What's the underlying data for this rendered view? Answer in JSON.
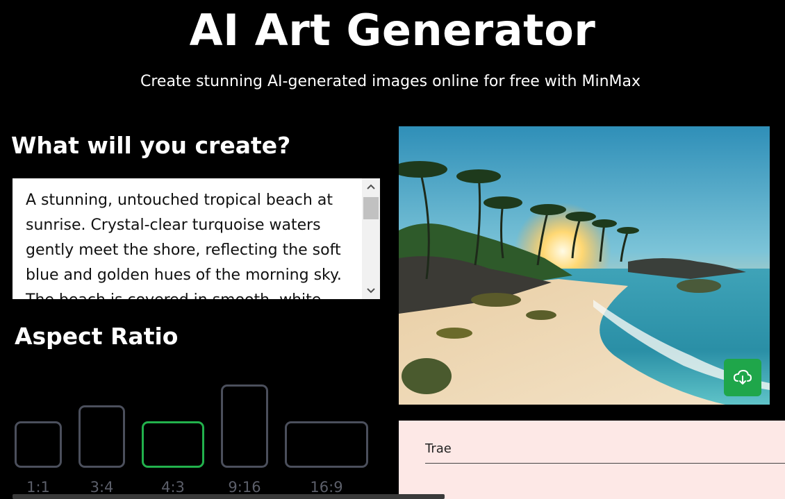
{
  "header": {
    "title": "AI Art Generator",
    "subtitle": "Create stunning AI-generated images online for free with MinMax"
  },
  "prompt": {
    "heading": "What will you create?",
    "value": "A stunning, untouched tropical beach at sunrise. Crystal-clear turquoise waters gently meet the shore, reflecting the soft blue and golden hues of the morning sky. The beach is covered in smooth, white sand"
  },
  "aspect_ratio": {
    "heading": "Aspect Ratio",
    "selected": "4:3",
    "options": [
      {
        "label": "1:1"
      },
      {
        "label": "3:4"
      },
      {
        "label": "4:3"
      },
      {
        "label": "9:16"
      },
      {
        "label": "16:9"
      }
    ]
  },
  "preview": {
    "download_icon": "cloud-download-icon"
  },
  "panel": {
    "input_value": "Trae"
  },
  "colors": {
    "accent": "#22b14c",
    "download_bg": "#1fa64a",
    "panel_bg": "#fde8e6",
    "ratio_border": "#4b4f5c"
  }
}
